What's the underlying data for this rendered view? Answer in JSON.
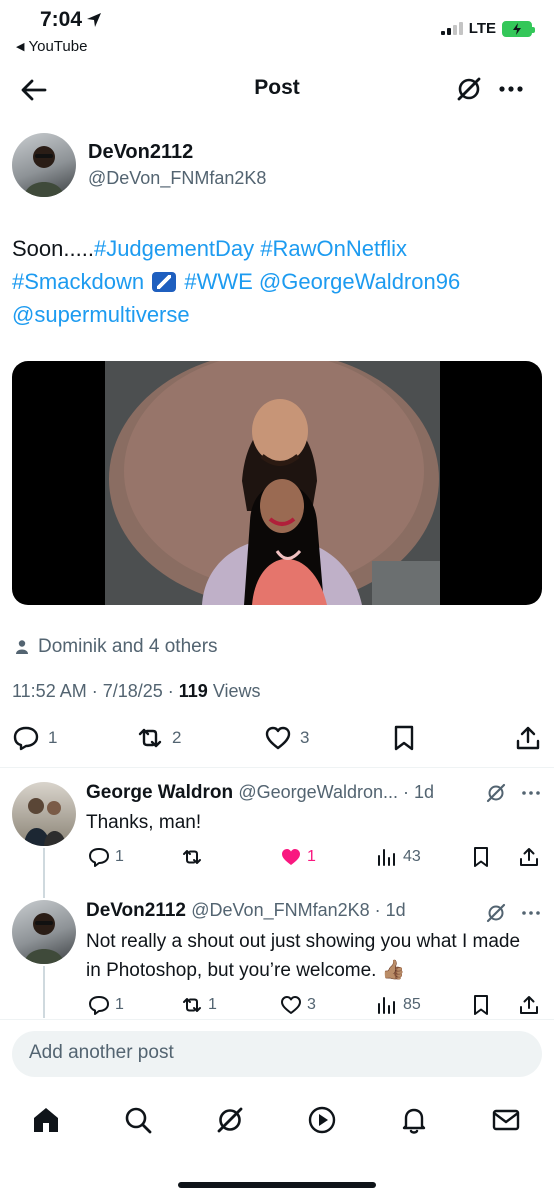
{
  "status_bar": {
    "time": "7:04",
    "back_app": "YouTube",
    "network": "LTE"
  },
  "header": {
    "title": "Post"
  },
  "post": {
    "author_name": "DeVon2112",
    "author_handle": "@DeVon_FNMfan2K8",
    "text": {
      "prefix": "Soon.....",
      "tag1": "#JudgementDay",
      "tag2": "#RawOnNetflix",
      "tag3": "#Smackdown",
      "tag4": "#WWE",
      "mention1": "@GeorgeWaldron96",
      "mention2": "@supermultiverse"
    },
    "liked_by": "Dominik and 4 others",
    "timestamp": "11:52 AM · 7/18/25 · ",
    "views_count": "119",
    "views_label": " Views",
    "replies": "1",
    "reposts": "2",
    "likes": "3"
  },
  "replies": [
    {
      "name": "George Waldron",
      "handle": "@GeorgeWaldron... · 1d",
      "text": "Thanks, man!",
      "reply_count": "1",
      "repost_count": "",
      "like_count": "1",
      "views": "43",
      "liked": true
    },
    {
      "name": "DeVon2112",
      "handle": "@DeVon_FNMfan2K8 · 1d",
      "text": "Not really a shout out just showing you what I made in Photoshop, but you’re welcome. 👍🏽",
      "reply_count": "1",
      "repost_count": "1",
      "like_count": "3",
      "views": "85",
      "liked": false
    }
  ],
  "composer": {
    "placeholder": "Add another post"
  },
  "colors": {
    "accent": "#1d9bf0",
    "like": "#f91880",
    "text": "#0f1419",
    "muted": "#536471"
  },
  "icons": [
    "back-arrow-icon",
    "grok-icon",
    "more-icon",
    "person-icon",
    "reply-icon",
    "repost-icon",
    "heart-icon",
    "bookmark-icon",
    "share-icon",
    "views-icon",
    "home-icon",
    "search-icon",
    "play-icon",
    "bell-icon",
    "mail-icon"
  ]
}
